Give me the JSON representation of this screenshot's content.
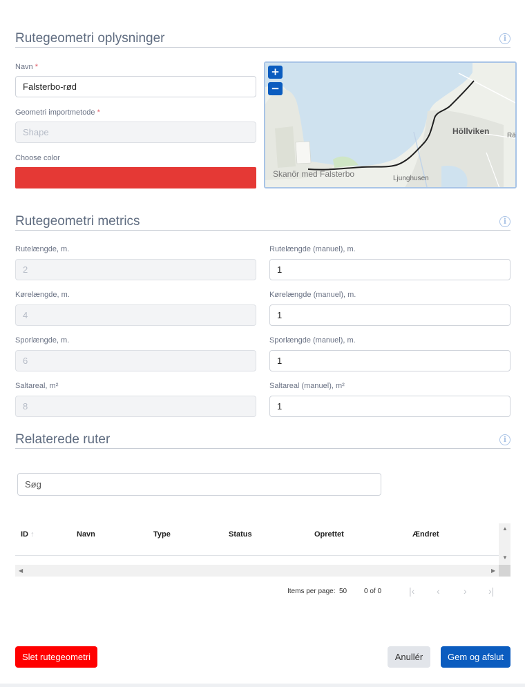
{
  "sections": {
    "info_title": "Rutegeometri oplysninger",
    "metrics_title": "Rutegeometri metrics",
    "related_title": "Relaterede ruter"
  },
  "info": {
    "name_label": "Navn",
    "name_required": "*",
    "name_value": "Falsterbo-rød",
    "import_label": "Geometri importmetode",
    "import_required": "*",
    "import_value": "Shape",
    "color_label": "Choose color",
    "color_value": "#e53935"
  },
  "map": {
    "zoom_in": "+",
    "zoom_out": "−",
    "place_hollviken": "Höllviken",
    "place_skanor": "Skanör med Falsterbo",
    "place_ljunghusen": "Ljunghusen",
    "place_ra": "Rä"
  },
  "metrics": {
    "rute_label": "Rutelængde, m.",
    "rute_value": "2",
    "rute_manual_label": "Rutelængde (manuel), m.",
    "rute_manual_value": "1",
    "kore_label": "Kørelængde, m.",
    "kore_value": "4",
    "kore_manual_label": "Kørelængde (manuel), m.",
    "kore_manual_value": "1",
    "spor_label": "Sporlængde, m.",
    "spor_value": "6",
    "spor_manual_label": "Sporlængde (manuel), m.",
    "spor_manual_value": "1",
    "salt_label": "Saltareal, m²",
    "salt_value": "8",
    "salt_manual_label": "Saltareal (manuel), m²",
    "salt_manual_value": "1"
  },
  "related": {
    "search_placeholder": "Søg",
    "columns": [
      "ID",
      "Navn",
      "Type",
      "Status",
      "Oprettet",
      "Ændret"
    ],
    "sort_indicator": "↑",
    "items_per_page_label": "Items per page:",
    "items_per_page_value": "50",
    "range": "0 of 0"
  },
  "actions": {
    "delete": "Slet rutegeometri",
    "cancel": "Anullér",
    "save": "Gem og afslut"
  },
  "icons": {
    "info": "info-icon",
    "first_page": "first-page-icon",
    "prev_page": "prev-page-icon",
    "next_page": "next-page-icon",
    "last_page": "last-page-icon"
  }
}
